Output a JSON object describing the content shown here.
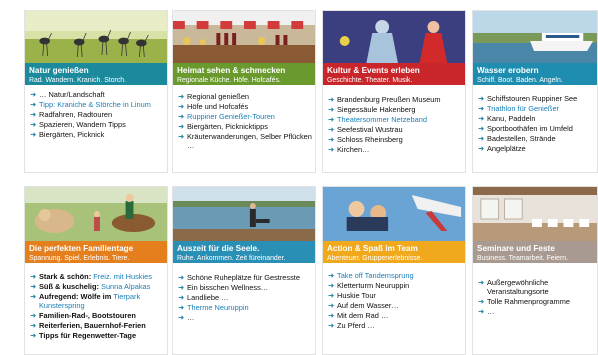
{
  "cards": [
    {
      "title": "Natur genießen",
      "subtitle": "Rad. Wandern. Kranich. Storch.",
      "color": "#1b8a9c",
      "items": [
        {
          "text": "… Natur/Landschaft",
          "link": false
        },
        {
          "text": "Tipp: Kraniche & Störche in Linum",
          "link": true
        },
        {
          "text": "Radfahren, Radtouren",
          "link": false
        },
        {
          "text": "Spazieren, Wandern Tipps",
          "link": false
        },
        {
          "text": "Biergärten, Picknick",
          "link": false
        }
      ]
    },
    {
      "title": "Heimat sehen & schmecken",
      "subtitle": "Regionale Küche. Höfe. Hofcafés.",
      "color": "#6a9a2e",
      "items": [
        {
          "text": "Regional genießen",
          "link": false
        },
        {
          "text": "Höfe und Hofcafés",
          "link": false
        },
        {
          "text": "Ruppiner Genießer-Touren",
          "link": true
        },
        {
          "text": "Biergärten, Picknicktipps",
          "link": false
        },
        {
          "text": "Kräuterwanderungen, Selber Pflücken …",
          "link": false
        }
      ]
    },
    {
      "title": "Kultur & Events erleben",
      "subtitle": "Geschichte. Theater. Musik.",
      "color": "#c8262a",
      "items": [
        {
          "text": "Brandenburg Preußen Museum",
          "link": false
        },
        {
          "text": "Siegessäule Hakenberg",
          "link": false
        },
        {
          "text": "Theatersommer Netzeband",
          "link": true
        },
        {
          "text": "Seefestival Wustrau",
          "link": false
        },
        {
          "text": "Schloss Rheinsberg",
          "link": false
        },
        {
          "text": "Kirchen…",
          "link": false
        }
      ]
    },
    {
      "title": "Wasser erobern",
      "subtitle": "Schiff. Boot. Baden. Angeln.",
      "color": "#1f8db0",
      "items": [
        {
          "text": "Schiffstouren Ruppiner See",
          "link": false
        },
        {
          "text": "Triathlon für Genießer",
          "link": true
        },
        {
          "text": "Kanu, Paddeln",
          "link": false
        },
        {
          "text": "Sportboothäfen im Umfeld",
          "link": false
        },
        {
          "text": "Badestellen, Strände",
          "link": false
        },
        {
          "text": "Angelplätze",
          "link": false
        }
      ]
    },
    {
      "title": "Die perfekten Familientage",
      "subtitle": "Spannung. Spiel. Erlebnis. Tiere.",
      "color": "#e57f1e",
      "items": [
        {
          "pre": "Stark & schön: ",
          "hl": "Freiz. mit Huskies",
          "bold_pre": true
        },
        {
          "pre": "Süß & kuschelig: ",
          "hl": "Sunna Alpakas",
          "bold_pre": true
        },
        {
          "pre": "Aufregend: Wölfe im ",
          "hl": "Tierpark Kunsterspring",
          "bold_pre": true
        },
        {
          "pre": "Familien-Rad-, Bootstouren",
          "hl": "",
          "bold_pre": true
        },
        {
          "pre": "Reiterferien, Bauernhof-Ferien",
          "hl": "",
          "bold_pre": true
        },
        {
          "pre": "Tipps für Regenwetter-Tage",
          "hl": "",
          "bold_pre": true
        }
      ]
    },
    {
      "title": "Auszeit für die Seele.",
      "subtitle": "Ruhe. Ankommen. Zeit füreinander.",
      "color": "#2a8fb5",
      "items": [
        {
          "text": "Schöne Ruheplätze für Gestresste",
          "link": false
        },
        {
          "text": "Ein bisschen Wellness…",
          "link": false
        },
        {
          "text": "Landliebe …",
          "link": false
        },
        {
          "text": "Therme Neuruppin",
          "link": true
        },
        {
          "text": "…",
          "link": false
        }
      ]
    },
    {
      "title": "Action & Spaß im Team",
      "subtitle": "Abenteuer. Gruppenerlebnisse.",
      "color": "#f0a81c",
      "items": [
        {
          "text": "Take off Tandemsprung",
          "link": true
        },
        {
          "text": "Kletterturm Neuruppin",
          "link": false
        },
        {
          "text": "Huskie Tour",
          "link": false
        },
        {
          "text": "Auf dem Wasser…",
          "link": false
        },
        {
          "text": "Mit dem Rad …",
          "link": false
        },
        {
          "text": "Zu Pferd …",
          "link": false
        }
      ]
    },
    {
      "title": "Seminare und Feste",
      "subtitle": "Business. Teamarbeit. Feiern.",
      "color": "#a89a90",
      "items": [
        {
          "text": "Außergewöhnliche Veranstaltungsorte",
          "link": false
        },
        {
          "text": "Tolle Rahmenprogramme",
          "link": false
        },
        {
          "text": "…",
          "link": false
        }
      ]
    }
  ]
}
